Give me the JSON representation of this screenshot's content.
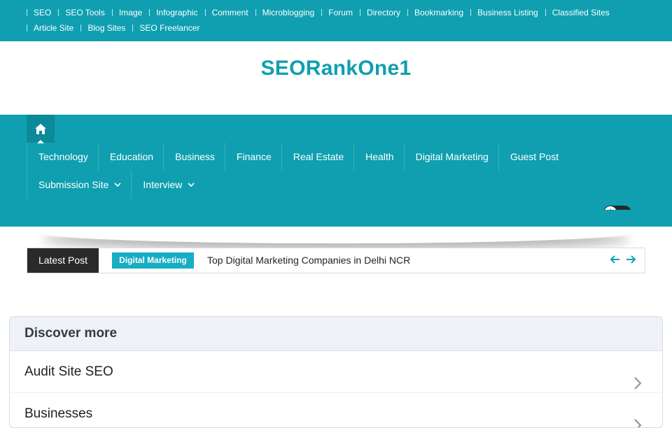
{
  "topbar": {
    "links": [
      "SEO",
      "SEO Tools",
      "Image",
      "Infographic",
      "Comment",
      "Microblogging",
      "Forum",
      "Directory",
      "Bookmarking",
      "Business Listing",
      "Classified Sites",
      "Article Site",
      "Blog Sites",
      "SEO Freelancer"
    ]
  },
  "site": {
    "title": "SEORankOne1"
  },
  "nav": {
    "home_icon": "home-icon",
    "row1": [
      "Technology",
      "Education",
      "Business",
      "Finance",
      "Real Estate",
      "Health",
      "Digital Marketing",
      "Guest Post"
    ],
    "row2": [
      "Submission Site",
      "Interview"
    ],
    "dark_mode_icon": "sun-icon"
  },
  "ticker": {
    "label": "Latest Post",
    "category": "Digital Marketing",
    "headline": "Top Digital Marketing Companies in Delhi NCR"
  },
  "discover": {
    "title": "Discover more",
    "items": [
      "Audit Site SEO",
      "Businesses"
    ]
  },
  "colors": {
    "brand": "#0f9fb0",
    "ticker_label_bg": "#2a2a2a",
    "ticker_category_bg": "#17aec4"
  }
}
